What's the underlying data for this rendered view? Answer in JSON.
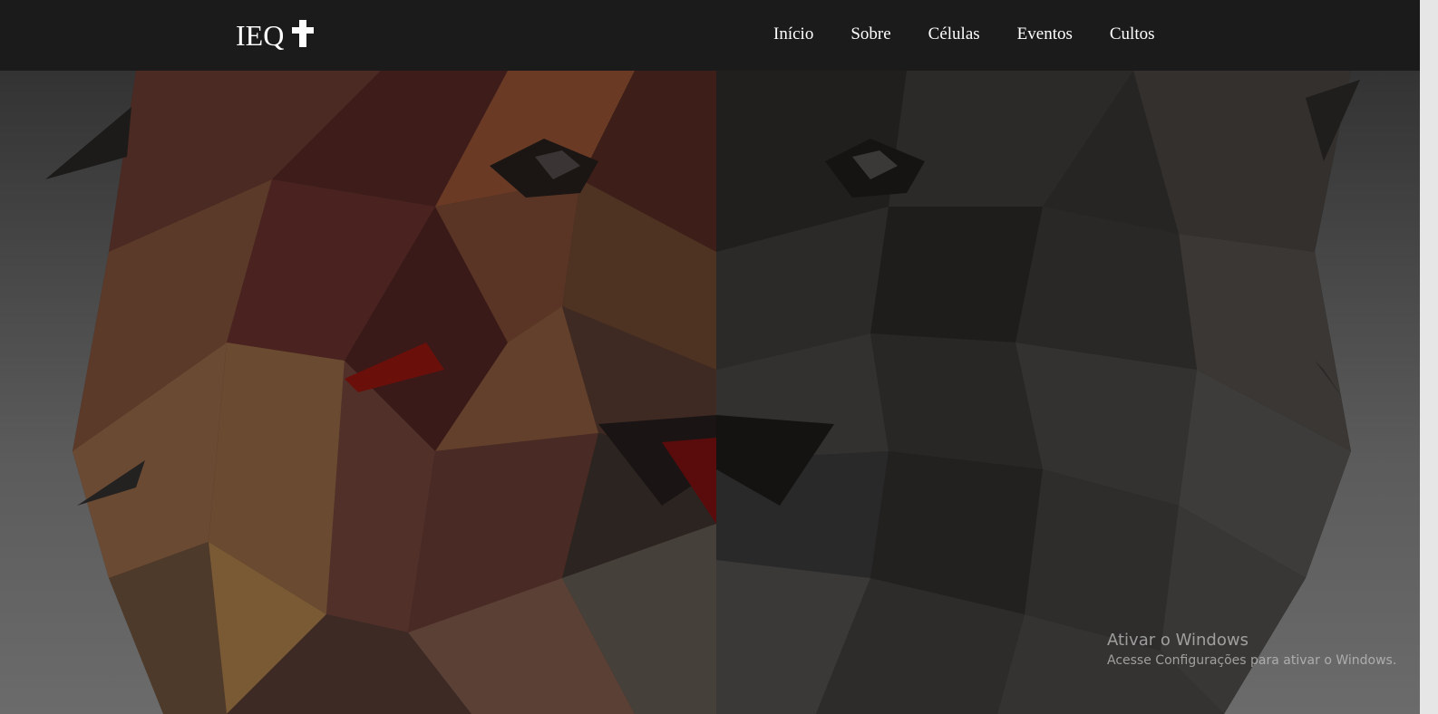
{
  "header": {
    "brand": "IEQ",
    "brand_icon": "cross-icon",
    "nav": [
      {
        "label": "Início"
      },
      {
        "label": "Sobre"
      },
      {
        "label": "Células"
      },
      {
        "label": "Eventos"
      },
      {
        "label": "Cultos"
      }
    ]
  },
  "hero": {
    "image": "low-poly-lion-face"
  },
  "watermark": {
    "title": "Ativar o Windows",
    "subtitle": "Acesse Configurações para ativar o Windows."
  },
  "colors": {
    "navbar": "#1c1b1c",
    "text": "#ffffff"
  }
}
